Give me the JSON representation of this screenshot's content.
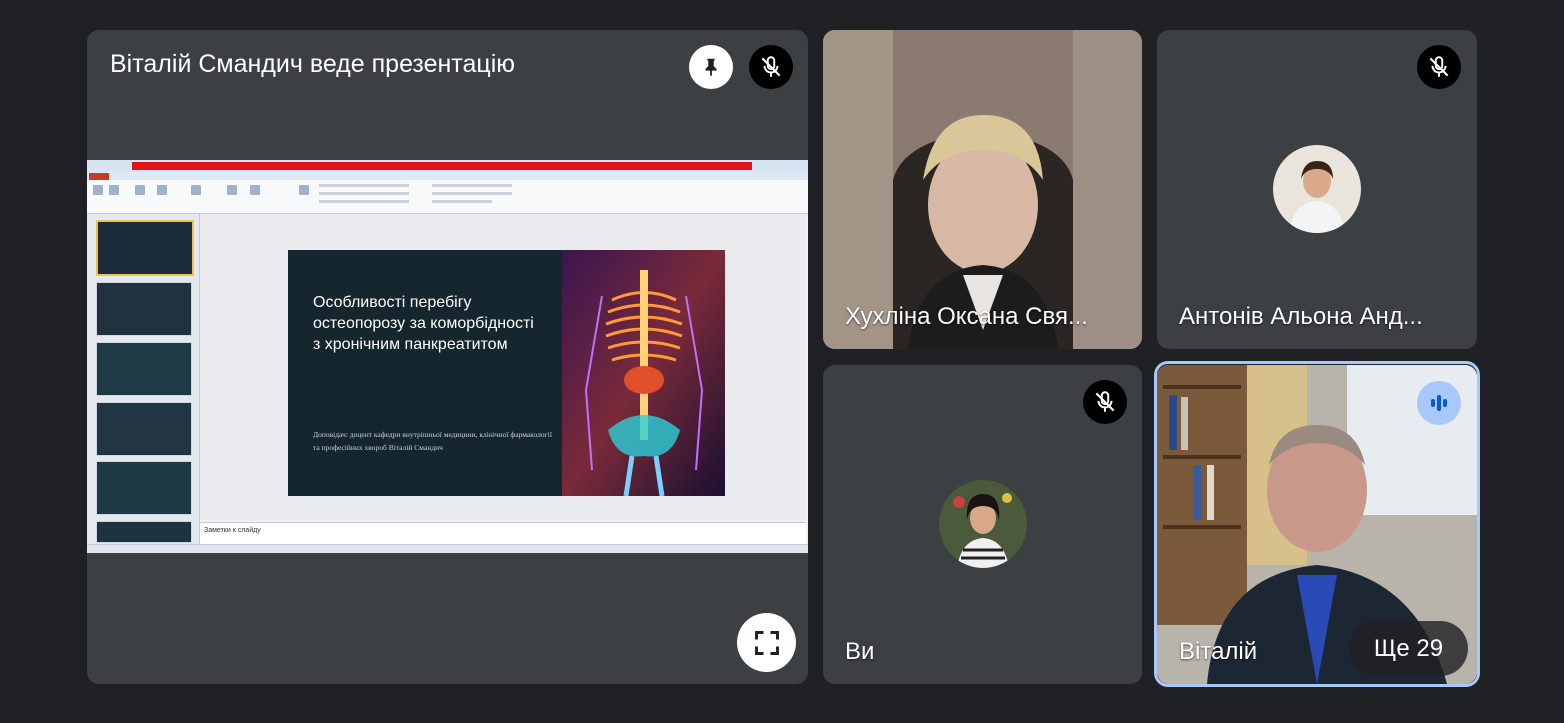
{
  "presentation": {
    "title": "Віталій Смандич веде презентацію",
    "slide": {
      "title": "Особливості перебігу остеопорозу за коморбідності з хронічним панкреатитом",
      "subtitle": "Доповідач: доцент кафедри внутрішньої медицини, клінічної фармакології та професійних хвороб Віталій Смандич"
    },
    "notes_placeholder": "Заметки к слайду"
  },
  "participants": [
    {
      "name": "Хухліна Оксана Свя...",
      "mic": "on"
    },
    {
      "name": "Антонів Альона Анд...",
      "mic": "muted"
    },
    {
      "name": "Ви",
      "mic": "muted"
    },
    {
      "name": "Віталій",
      "mic": "speaking"
    }
  ],
  "more_participants": "Ще 29",
  "icons": {
    "pin": "pin-icon",
    "mic_off": "mic-off-icon",
    "fullscreen": "fullscreen-icon",
    "speaking": "audio-level-icon"
  },
  "colors": {
    "background": "#202124",
    "tile": "#3c4043",
    "active_speaker_border": "#a8c7fa",
    "pptx_title_bar": "#e0141e"
  }
}
